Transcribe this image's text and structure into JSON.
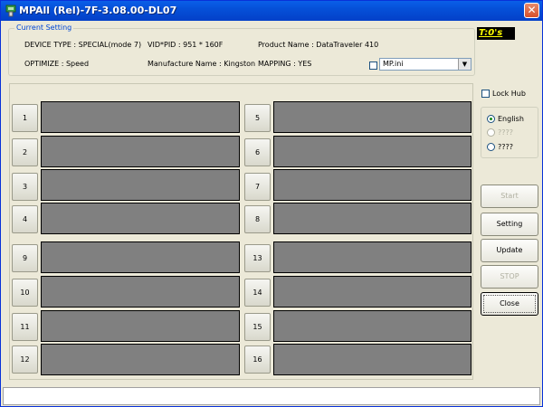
{
  "window": {
    "title": "MPAll (Rel)-7F-3.08.00-DL07"
  },
  "settings": {
    "legend": "Current Setting",
    "device_type": "DEVICE TYPE : SPECIAL(mode 7)",
    "vid_pid": "VID*PID :  951 * 160F",
    "product_name": "Product Name : DataTraveler 410",
    "optimize": "OPTIMIZE : Speed",
    "manufacture_name": "Manufacture Name : Kingston",
    "mapping": "MAPPING : YES",
    "ini_file": "MP.ini"
  },
  "timer": "T:0's",
  "ports": [
    "1",
    "2",
    "3",
    "4",
    "5",
    "6",
    "7",
    "8",
    "9",
    "10",
    "11",
    "12",
    "13",
    "14",
    "15",
    "16"
  ],
  "lock_hub": "Lock Hub",
  "languages": [
    {
      "label": "English",
      "selected": true,
      "enabled": true
    },
    {
      "label": "????",
      "selected": false,
      "enabled": false
    },
    {
      "label": "????",
      "selected": false,
      "enabled": true
    }
  ],
  "buttons": {
    "start": "Start",
    "setting": "Setting",
    "update": "Update",
    "stop": "STOP",
    "close": "Close"
  },
  "status": ""
}
